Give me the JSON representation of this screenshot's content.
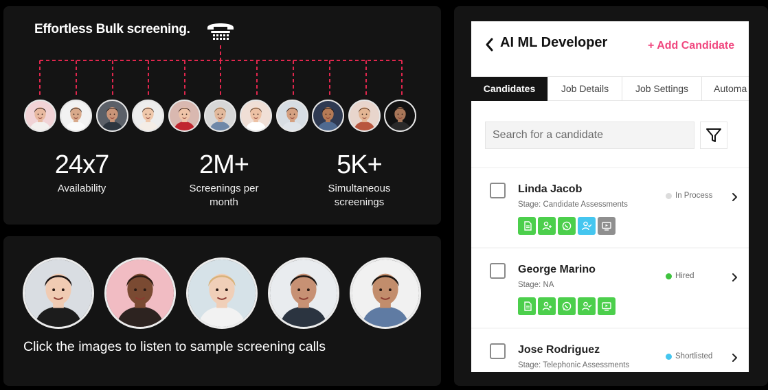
{
  "hero": {
    "headline": "Effortless Bulk screening.",
    "stats": [
      {
        "value": "24x7",
        "label_lines": [
          "Availability"
        ]
      },
      {
        "value": "2M+",
        "label_lines": [
          "Screenings per",
          "month"
        ]
      },
      {
        "value": "5K+",
        "label_lines": [
          "Simultaneous",
          "screenings"
        ]
      }
    ],
    "connector_color": "#e0264d",
    "avatar_icon": "person-avatar-icon"
  },
  "samples": {
    "caption": "Click the images to listen to sample screening calls"
  },
  "app": {
    "job_title": "AI ML Developer",
    "add_candidate_label": "+ Add Candidate",
    "accent_color": "#f0467e",
    "tabs": [
      {
        "label": "Candidates",
        "active": true
      },
      {
        "label": "Job Details",
        "active": false
      },
      {
        "label": "Job Settings",
        "active": false
      },
      {
        "label": "Automa",
        "active": false
      }
    ],
    "search": {
      "placeholder": "Search for a candidate"
    },
    "candidates": [
      {
        "name": "Linda Jacob",
        "stage": "Stage: Candidate Assessments",
        "status": "In Process",
        "status_color": "#dcdcdc",
        "actions": [
          "document-icon",
          "add-user-icon",
          "whatsapp-icon",
          "user-check-icon",
          "video-screen-icon"
        ],
        "action_colors": [
          "#4ccf4c",
          "#4ccf4c",
          "#4ccf4c",
          "#45c6ef",
          "#8f8f8f"
        ]
      },
      {
        "name": "George Marino",
        "stage": "Stage: NA",
        "status": "Hired",
        "status_color": "#3fc33f",
        "actions": [
          "document-icon",
          "add-user-icon",
          "whatsapp-icon",
          "user-check-icon",
          "video-screen-icon"
        ],
        "action_colors": [
          "#4ccf4c",
          "#4ccf4c",
          "#4ccf4c",
          "#4ccf4c",
          "#4ccf4c"
        ]
      },
      {
        "name": "Jose Rodriguez",
        "stage": "Stage: Telephonic Assessments",
        "status": "Shortlisted",
        "status_color": "#45c6ef",
        "actions": [],
        "action_colors": []
      }
    ]
  }
}
